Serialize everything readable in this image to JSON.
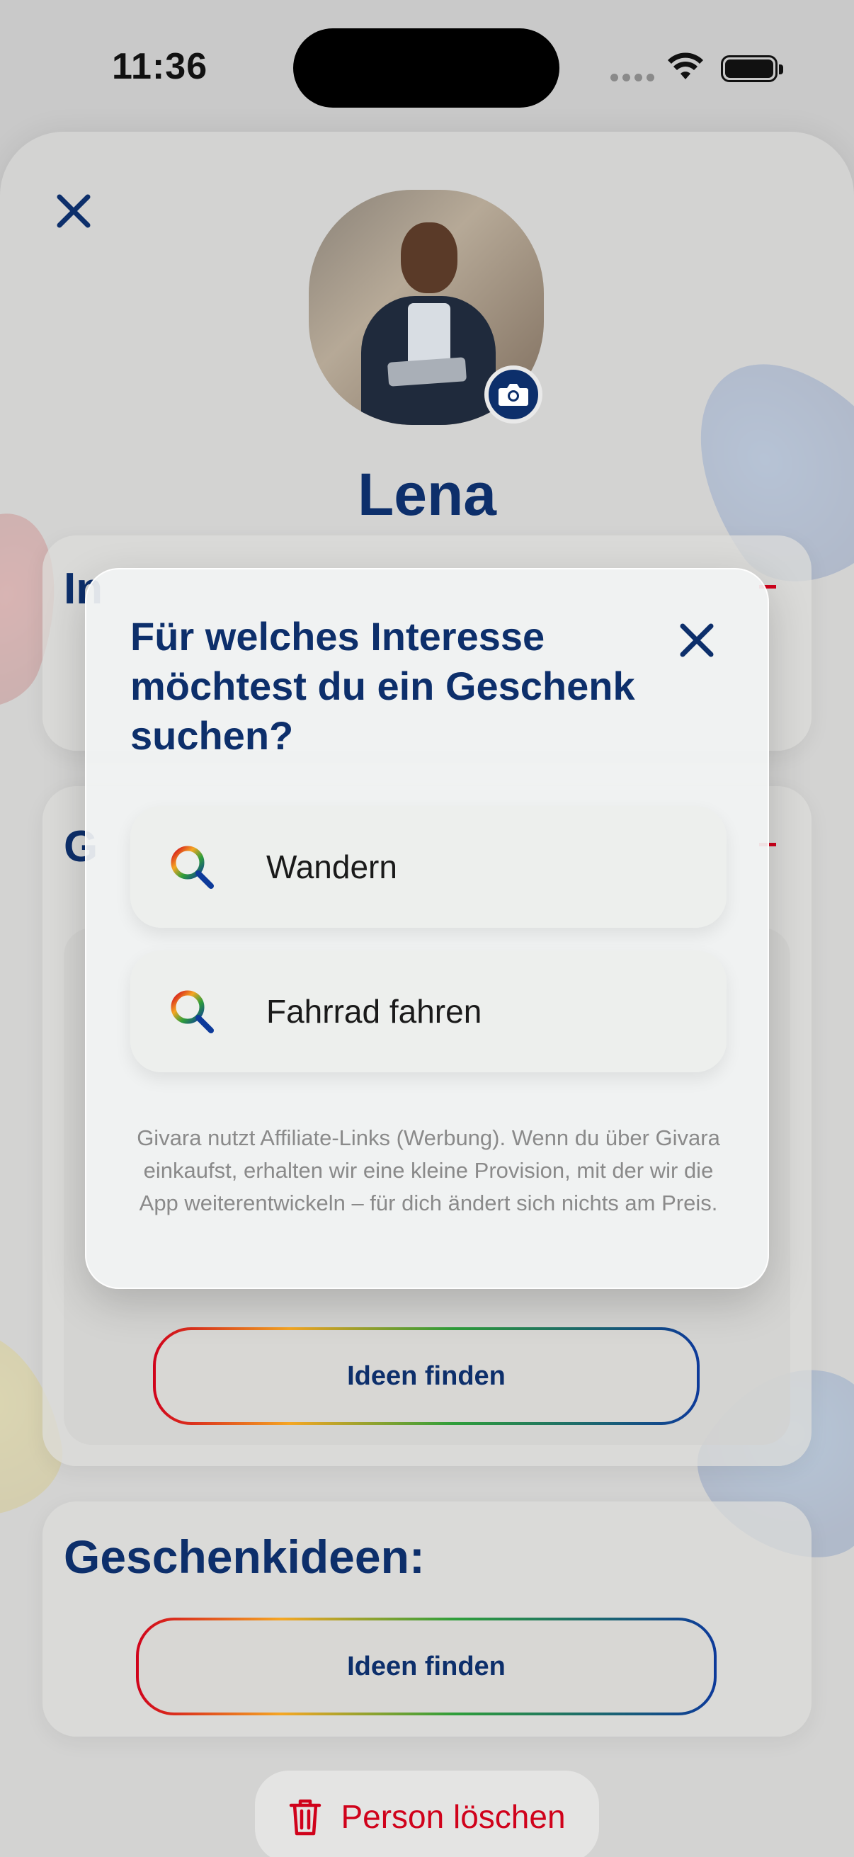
{
  "status_bar": {
    "time": "11:36"
  },
  "profile": {
    "name": "Lena"
  },
  "cards": {
    "interests_title_partial": "In",
    "gifts_title_partial": "G",
    "gift_ideas_title": "Geschenkideen:",
    "find_ideas_label": "Ideen finden",
    "find_ideas_label_2": "Ideen finden"
  },
  "delete": {
    "label": "Person löschen"
  },
  "modal": {
    "title": "Für welches Interesse möchtest du ein Geschenk suchen?",
    "options": [
      {
        "label": "Wandern"
      },
      {
        "label": "Fahrrad fahren"
      }
    ],
    "disclaimer": "Givara nutzt Affiliate-Links (Werbung). Wenn du über Givara einkaufst, erhalten wir eine kleine Provision, mit der wir die App weiterentwickeln – für dich ändert sich nichts am Preis."
  },
  "colors": {
    "primary": "#0d2f6b",
    "danger": "#d0021b"
  },
  "icons": {
    "close": "close-icon",
    "camera": "camera-icon",
    "search": "search-icon",
    "trash": "trash-icon",
    "wifi": "wifi-icon",
    "battery": "battery-icon"
  }
}
